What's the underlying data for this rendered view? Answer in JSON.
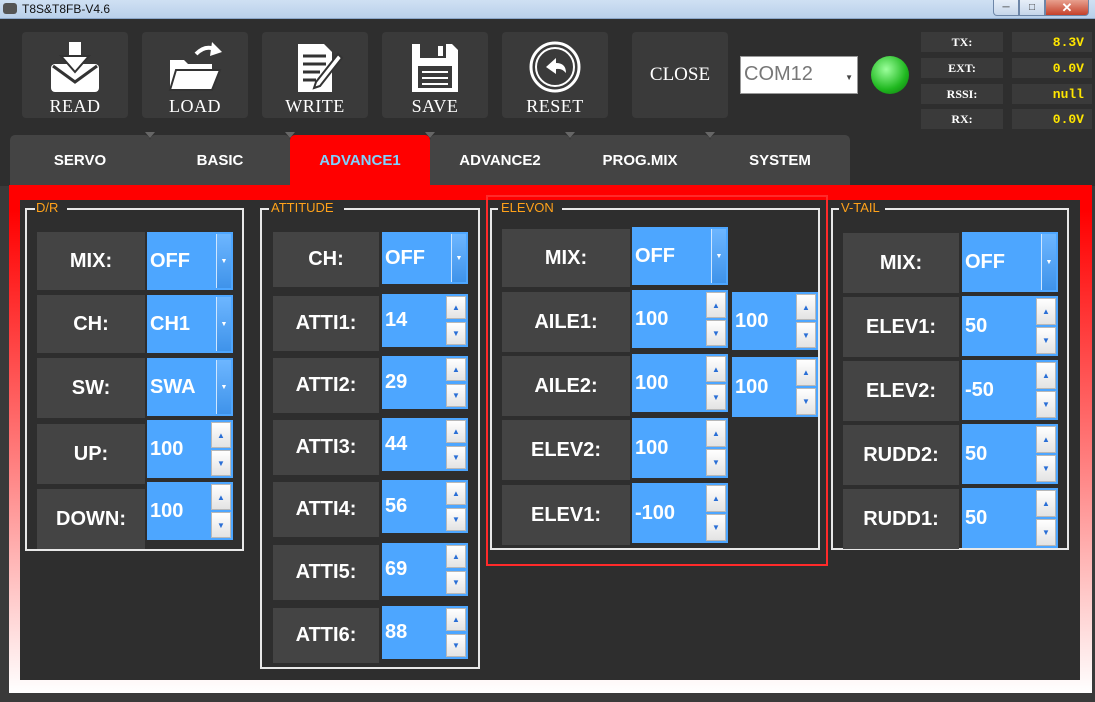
{
  "window": {
    "title": "T8S&T8FB-V4.6"
  },
  "toolbar": {
    "buttons": [
      {
        "label": "READ",
        "icon": "envelope-download-icon"
      },
      {
        "label": "LOAD",
        "icon": "folder-open-icon"
      },
      {
        "label": "WRITE",
        "icon": "document-pen-icon"
      },
      {
        "label": "SAVE",
        "icon": "floppy-disk-icon"
      },
      {
        "label": "RESET",
        "icon": "circle-return-icon"
      }
    ],
    "close_label": "CLOSE",
    "port": "COM12",
    "status": {
      "tx_label": "TX:",
      "tx_value": "8.3V",
      "ext_label": "EXT:",
      "ext_value": "0.0V",
      "rssi_label": "RSSI:",
      "rssi_value": "null",
      "rx_label": "RX:",
      "rx_value": "0.0V"
    },
    "led_color": "#22c022"
  },
  "tabs": [
    "SERVO",
    "BASIC",
    "ADVANCE1",
    "ADVANCE2",
    "PROG.MIX",
    "SYSTEM"
  ],
  "active_tab": "ADVANCE1",
  "colors": {
    "accent": "#ff0000",
    "control": "#4da6ff",
    "group_title": "#ffa21a",
    "status_value": "#ffe600"
  },
  "dr": {
    "title": "D/R",
    "mix_label": "MIX:",
    "mix_value": "OFF",
    "ch_label": "CH:",
    "ch_value": "CH1",
    "sw_label": "SW:",
    "sw_value": "SWA",
    "up_label": "UP:",
    "up_value": "100",
    "down_label": "DOWN:",
    "down_value": "100"
  },
  "attitude": {
    "title": "ATTITUDE",
    "ch_label": "CH:",
    "ch_value": "OFF",
    "atti1_label": "ATTI1:",
    "atti1_value": "14",
    "atti2_label": "ATTI2:",
    "atti2_value": "29",
    "atti3_label": "ATTI3:",
    "atti3_value": "44",
    "atti4_label": "ATTI4:",
    "atti4_value": "56",
    "atti5_label": "ATTI5:",
    "atti5_value": "69",
    "atti6_label": "ATTI6:",
    "atti6_value": "88"
  },
  "elevon": {
    "title": "ELEVON",
    "mix_label": "MIX:",
    "mix_value": "OFF",
    "aile1_label": "AILE1:",
    "aile1_value": "100",
    "aile1_value2": "100",
    "aile2_label": "AILE2:",
    "aile2_value": "100",
    "aile2_value2": "100",
    "elev2_label": "ELEV2:",
    "elev2_value": "100",
    "elev1_label": "ELEV1:",
    "elev1_value": "-100"
  },
  "vtail": {
    "title": "V-TAIL",
    "mix_label": "MIX:",
    "mix_value": "OFF",
    "elev1_label": "ELEV1:",
    "elev1_value": "50",
    "elev2_label": "ELEV2:",
    "elev2_value": "-50",
    "rudd2_label": "RUDD2:",
    "rudd2_value": "50",
    "rudd1_label": "RUDD1:",
    "rudd1_value": "50"
  }
}
